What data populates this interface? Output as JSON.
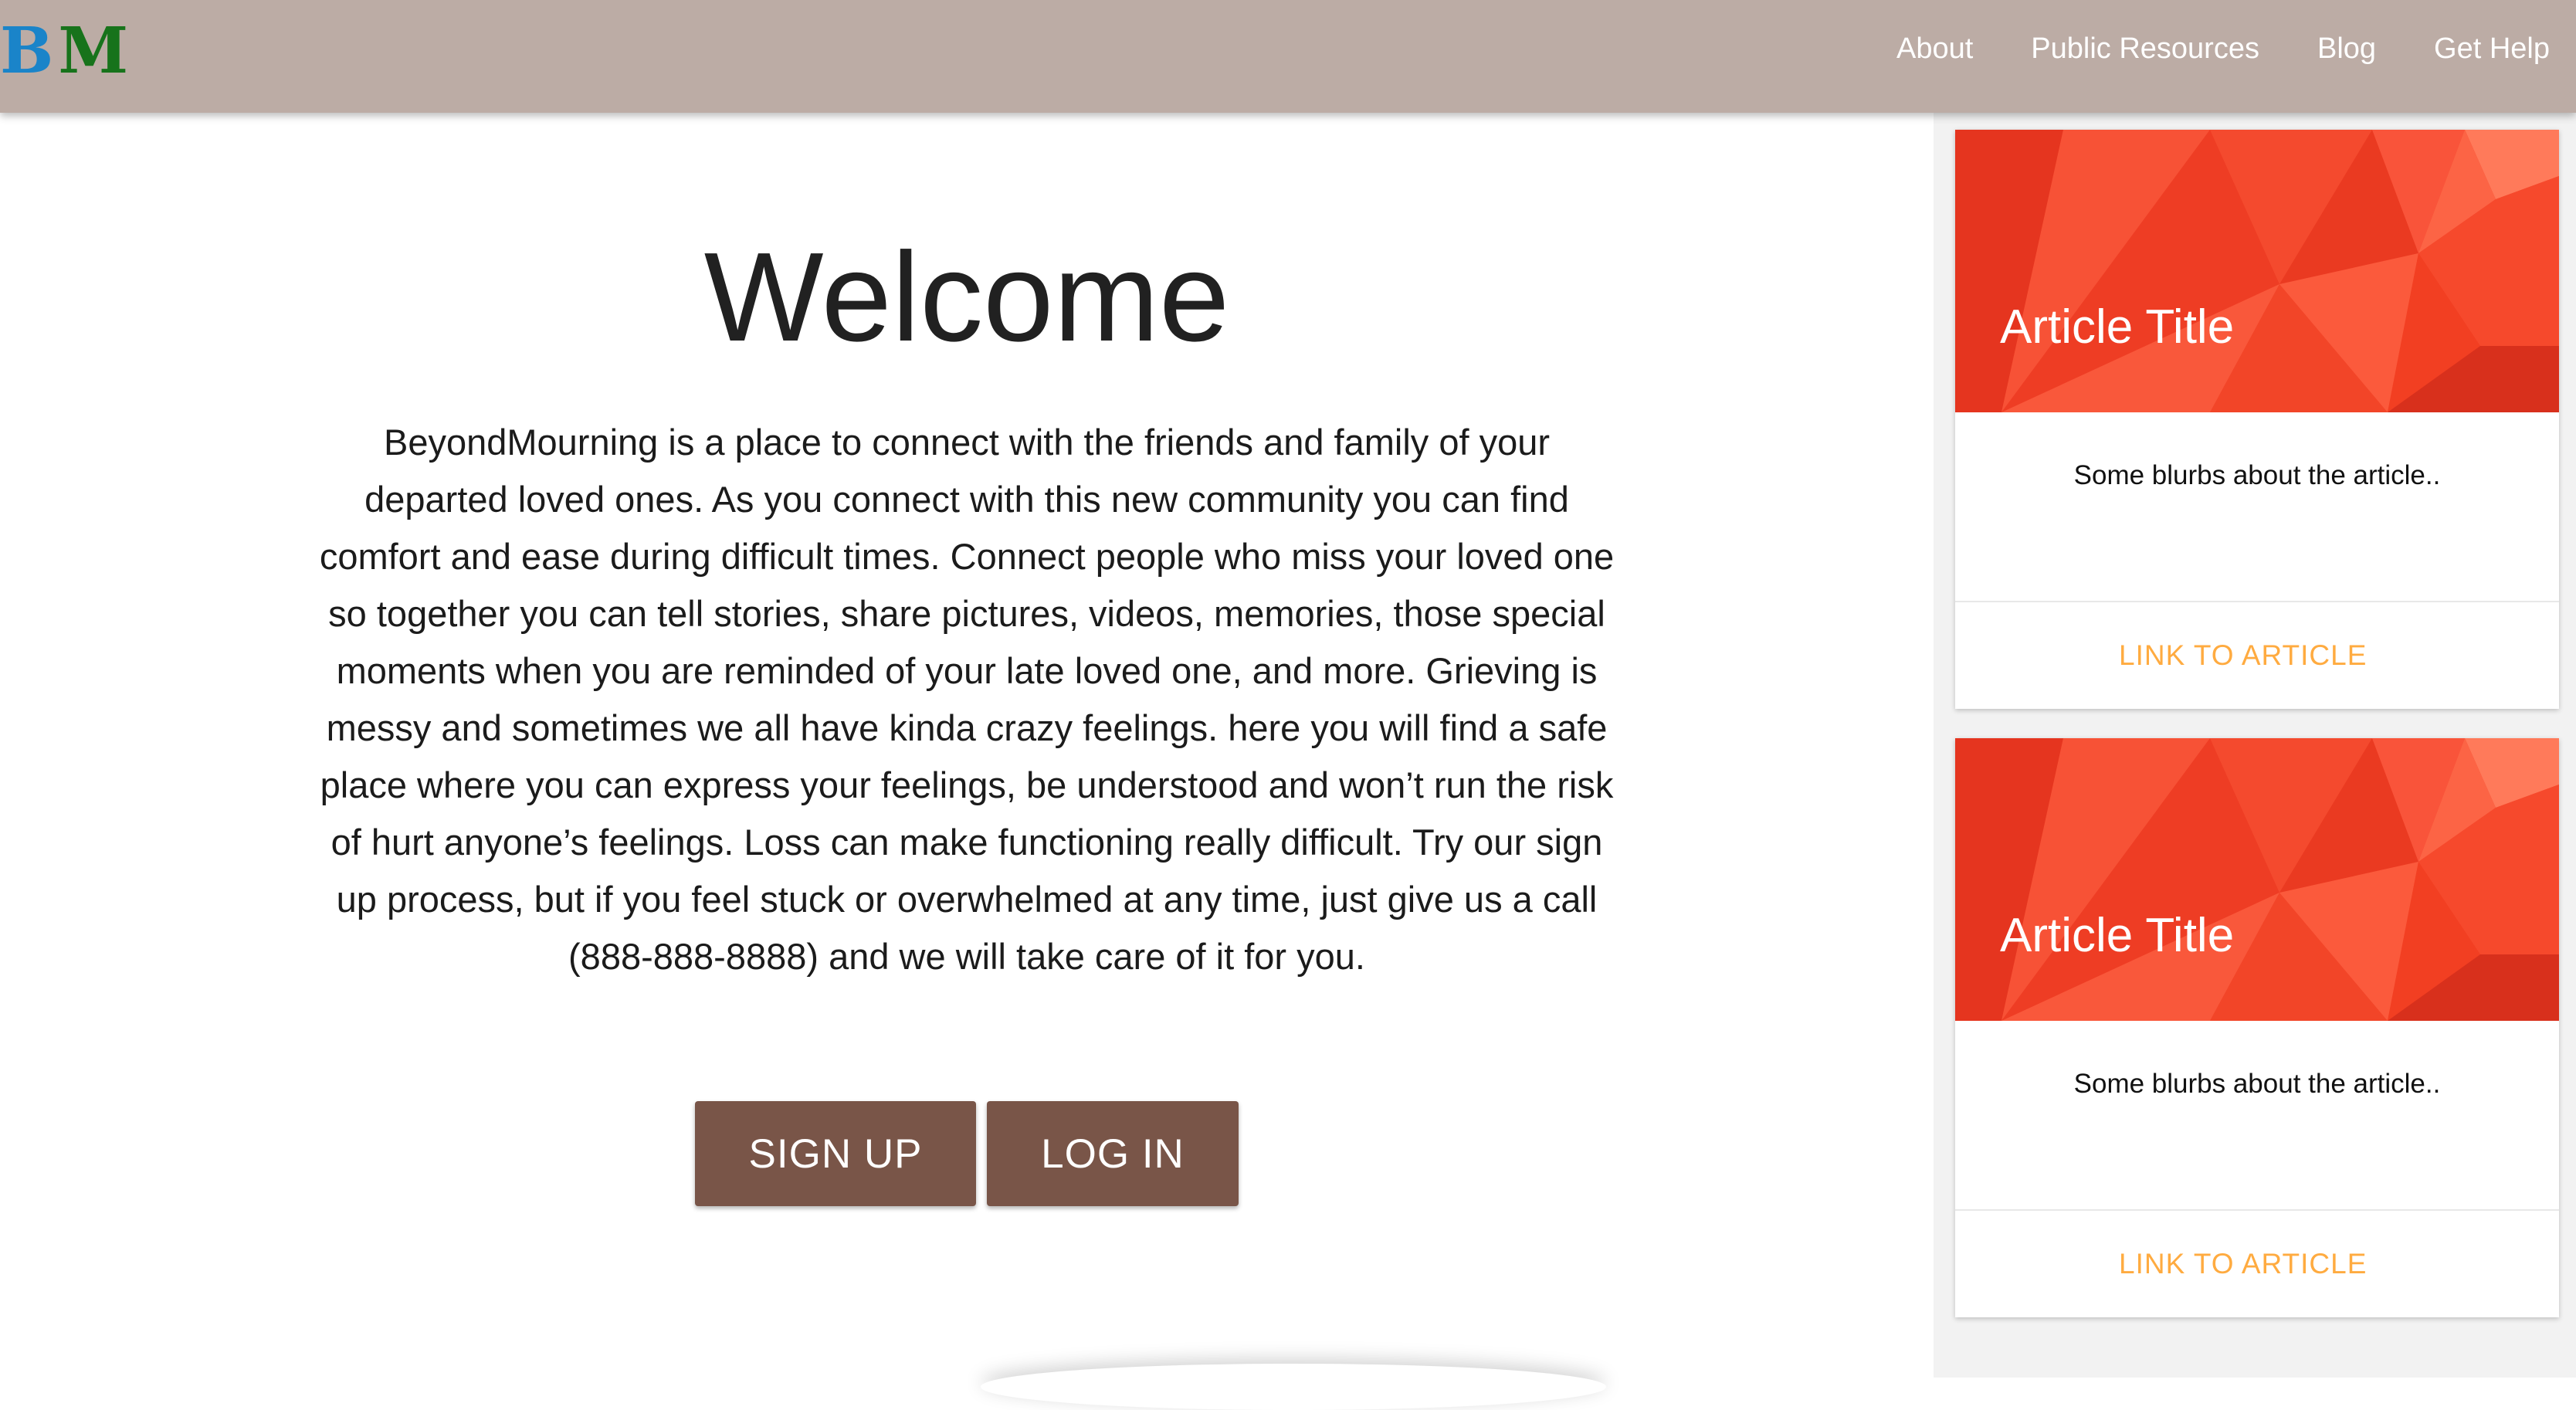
{
  "brand": {
    "logo_b": "B",
    "logo_m": "M",
    "colors": {
      "b": "#1a84c9",
      "m": "#17731b"
    }
  },
  "nav": {
    "background": "#bcaca5",
    "items": [
      {
        "label": "About"
      },
      {
        "label": "Public Resources"
      },
      {
        "label": "Blog"
      },
      {
        "label": "Get Help"
      }
    ]
  },
  "main": {
    "title": "Welcome",
    "intro": "BeyondMourning is a place to connect with the friends and family of your departed loved ones. As you connect with this new community you can find comfort and ease during difficult times. Connect people who miss your loved one so together you can tell stories, share pictures, videos, memories, those special moments when you are reminded of your late loved one, and more. Grieving is messy and sometimes we all have kinda crazy feelings. here you will find a safe place where you can express your feelings, be understood and won’t run the risk of hurt anyone’s feelings. Loss can make functioning really difficult. Try our sign up process, but if you feel stuck or overwhelmed at any time, just give us a call (888-888-8888) and we will take care of it for you.",
    "signup_label": "SIGN UP",
    "login_label": "LOG IN",
    "button_color": "#795548"
  },
  "sidebar": {
    "cards": [
      {
        "title": "Article Title",
        "blurb": "Some blurbs about the article..",
        "link_label": "LINK TO ARTICLE"
      },
      {
        "title": "Article Title",
        "blurb": "Some blurbs about the article..",
        "link_label": "LINK TO ARTICLE"
      }
    ],
    "link_color": "#ffab40",
    "image_color": "#f4432a"
  }
}
